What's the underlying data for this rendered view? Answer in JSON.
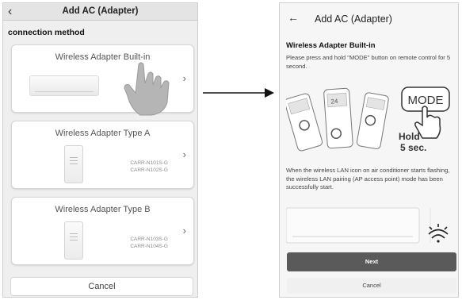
{
  "left_screen": {
    "header": {
      "back_icon": "chevron-left-icon",
      "title": "Add AC (Adapter)"
    },
    "section_label": "connection method",
    "options": [
      {
        "title": "Wireless Adapter Built-in",
        "models": []
      },
      {
        "title": "Wireless Adapter Type A",
        "models": [
          "CARR-N101S-G",
          "CARR-N102S-G"
        ]
      },
      {
        "title": "Wireless Adapter Type B",
        "models": [
          "CARR-N103S-G",
          "CARR-N104S-G"
        ]
      }
    ],
    "cancel_label": "Cancel"
  },
  "arrow_icon": "arrow-right-icon",
  "right_screen": {
    "header": {
      "back_icon": "arrow-left-icon",
      "title": "Add AC (Adapter)"
    },
    "heading": "Wireless Adapter Built-in",
    "instruction": "Please press and hold \"MODE\" button on remote control for 5 second.",
    "illustration": {
      "mode_label": "MODE",
      "hold_label": "Hold",
      "seconds_label": "5 sec."
    },
    "status_text": "When the wireless LAN icon on air conditioner starts flashing, the wireless LAN pairing (AP access point) mode has been successfully start.",
    "next_label": "Next",
    "cancel_label": "Cancel"
  },
  "colors": {
    "left_background": "#efefef",
    "card_background": "#ffffff",
    "next_button": "#5a5a5a",
    "right_background": "#f6f6f6"
  }
}
